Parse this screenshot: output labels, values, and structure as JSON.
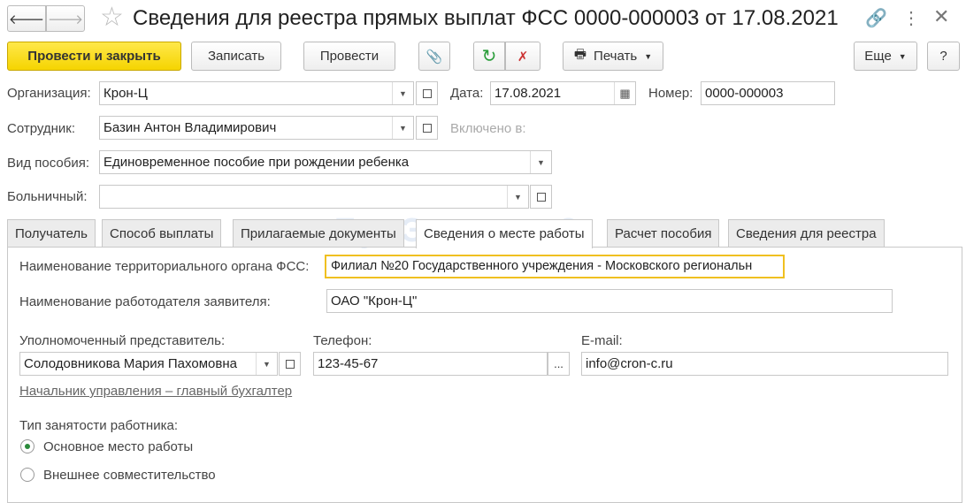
{
  "title": "Сведения для реестра прямых выплат ФСС 0000-000003 от 17.08.2021",
  "toolbar": {
    "post_close": "Провести и закрыть",
    "save": "Записать",
    "post": "Провести",
    "print": "Печать",
    "more": "Еще",
    "help": "?"
  },
  "form": {
    "org_label": "Организация:",
    "org_value": "Крон-Ц",
    "date_label": "Дата:",
    "date_value": "17.08.2021",
    "number_label": "Номер:",
    "number_value": "0000-000003",
    "employee_label": "Сотрудник:",
    "employee_value": "Базин Антон Владимирович",
    "included_label": "Включено в:",
    "benefit_label": "Вид пособия:",
    "benefit_value": "Единовременное пособие при рождении ребенка",
    "sick_label": "Больничный:",
    "sick_value": ""
  },
  "tabs": [
    {
      "label": "Получатель"
    },
    {
      "label": "Способ выплаты"
    },
    {
      "label": "Прилагаемые документы"
    },
    {
      "label": "Сведения о месте работы"
    },
    {
      "label": "Расчет пособия"
    },
    {
      "label": "Сведения для реестра"
    }
  ],
  "active_tab": "Сведения о месте работы",
  "work": {
    "fss_label": "Наименование территориального органа ФСС:",
    "fss_value": "Филиал №20 Государственного учреждения - Московского региональн",
    "employer_label": "Наименование работодателя заявителя:",
    "employer_value": "ОАО \"Крон-Ц\"",
    "rep_label": "Уполномоченный представитель:",
    "rep_value": "Солодовникова Мария Пахомовна",
    "phone_label": "Телефон:",
    "phone_value": "123-45-67",
    "phone_btn": "...",
    "email_label": "E-mail:",
    "email_value": "info@cron-c.ru",
    "rep_position": "Начальник управления – главный бухгалтер",
    "employment_label": "Тип занятости работника:",
    "options": [
      {
        "label": "Основное место работы",
        "selected": true
      },
      {
        "label": "Внешнее совместительство",
        "selected": false
      }
    ]
  },
  "watermark": "БухЭксперт8",
  "colors": {
    "accent": "#f5d400",
    "focus": "#f0c020",
    "link": "#555"
  }
}
